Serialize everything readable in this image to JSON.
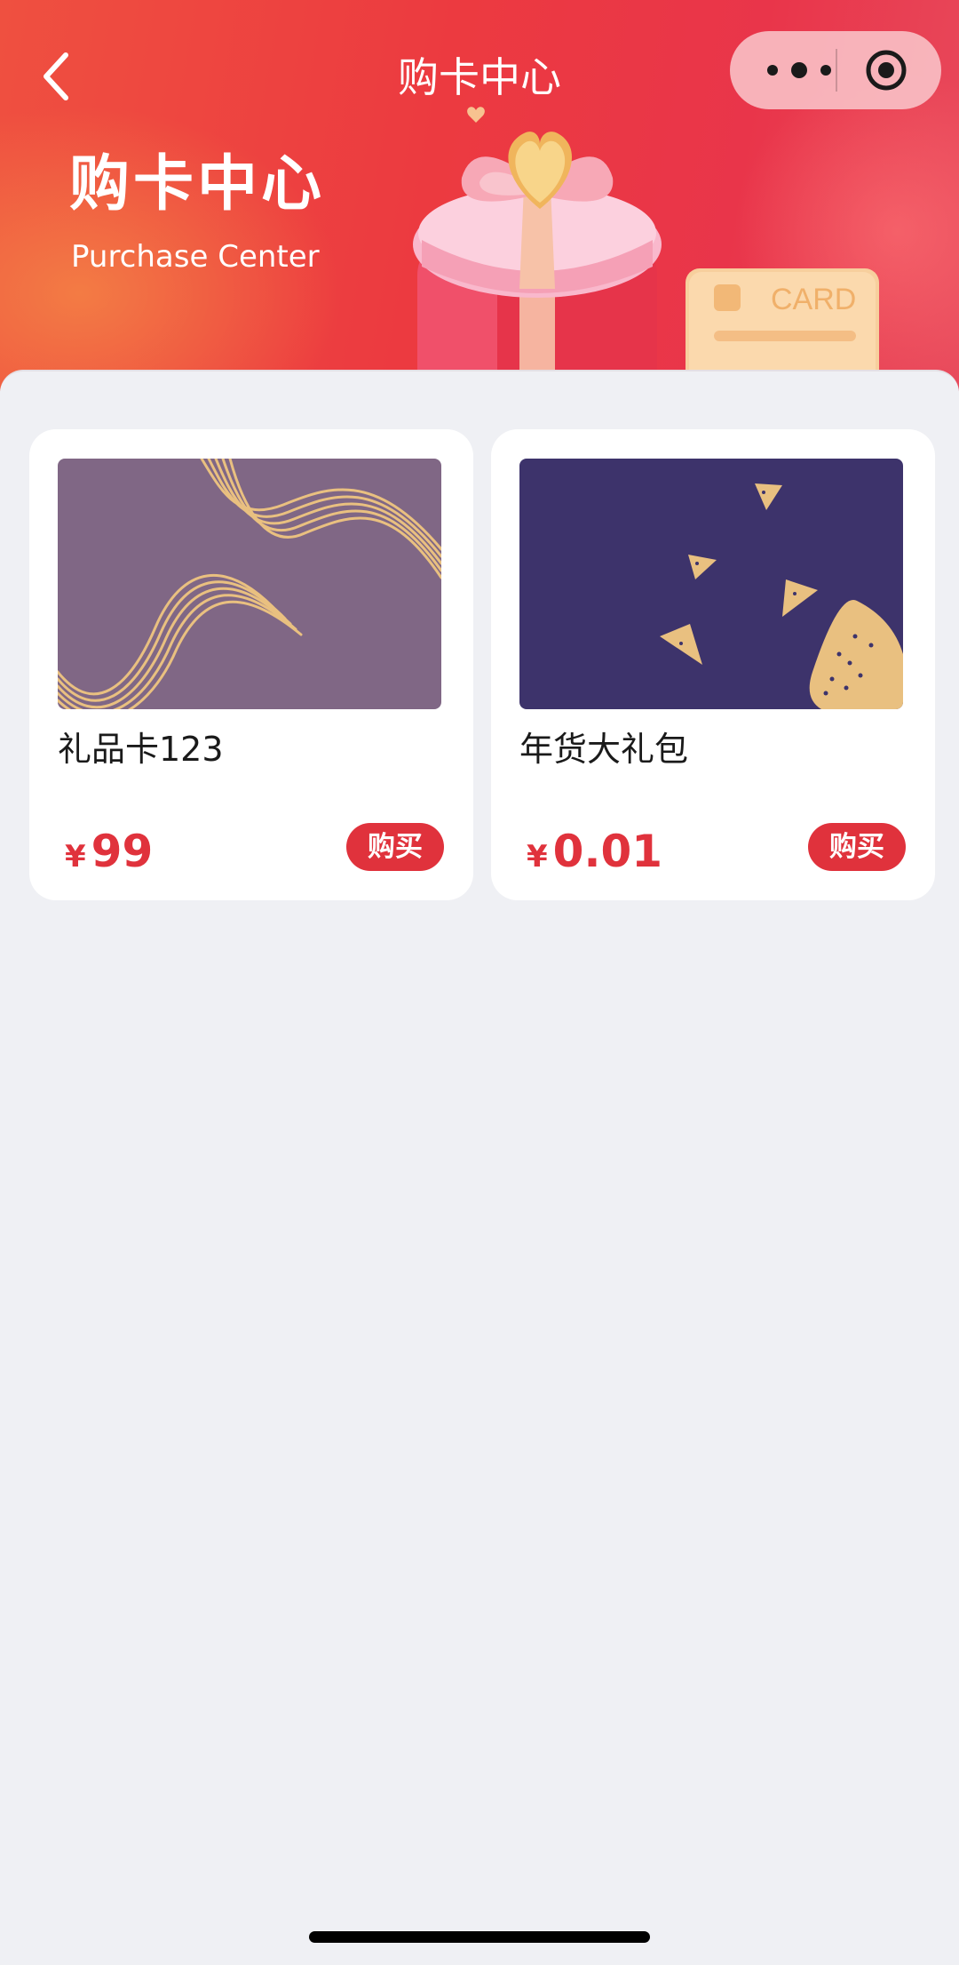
{
  "nav": {
    "title": "购卡中心",
    "back_icon": "chevron-left-icon",
    "more_icon": "more-dots-icon",
    "close_icon": "target-circle-icon"
  },
  "banner": {
    "title": "购卡中心",
    "subtitle": "Purchase Center",
    "illustration_card_text": "CARD"
  },
  "products": [
    {
      "name": "礼品卡123",
      "currency": "¥",
      "price": "99",
      "buy_label": "购买"
    },
    {
      "name": "年货大礼包",
      "currency": "¥",
      "price": "0.01",
      "buy_label": "购买"
    }
  ],
  "colors": {
    "accent": "#e0323c",
    "background": "#eff0f4",
    "card1_thumb": "#806785",
    "card2_thumb": "#3d336b",
    "thumb_pattern": "#e9c080"
  }
}
